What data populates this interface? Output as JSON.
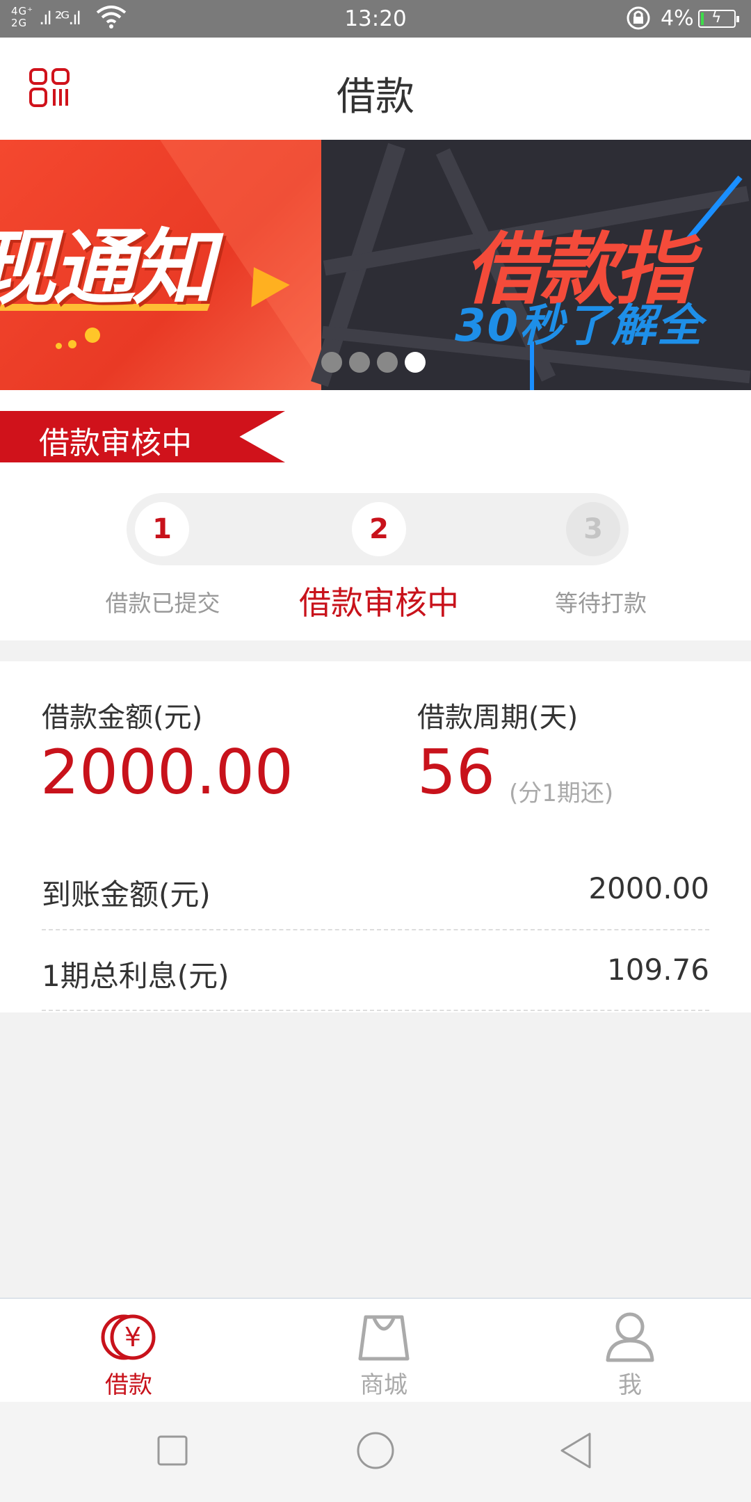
{
  "status_bar": {
    "network": "4G 2G",
    "signal2": "2G",
    "time": "13:20",
    "battery_percent": "4%",
    "icons": [
      "signal-icon",
      "wifi-icon",
      "rotation-lock-icon",
      "battery-charging-icon"
    ]
  },
  "header": {
    "title": "借款",
    "left_icon": "scan-icon"
  },
  "banner": {
    "slide_1_text": "现通知",
    "slide_2_title": "借款指",
    "slide_2_subtitle": "30秒了解全",
    "page_count": 4,
    "active_page": 4
  },
  "loan_status": {
    "ribbon": "借款审核中",
    "steps": [
      {
        "number": "1",
        "label": "借款已提交",
        "state": "done"
      },
      {
        "number": "2",
        "label": "借款审核中",
        "state": "current"
      },
      {
        "number": "3",
        "label": "等待打款",
        "state": "pending"
      }
    ]
  },
  "details": {
    "amount_label": "借款金额(元)",
    "amount_value": "2000.00",
    "period_label": "借款周期(天)",
    "period_value": "56",
    "period_note": "(分1期还)",
    "rows": [
      {
        "label": "到账金额(元)",
        "value": "2000.00"
      },
      {
        "label": "1期总利息(元)",
        "value": "109.76"
      }
    ]
  },
  "tabs": [
    {
      "label": "借款",
      "icon": "yuan-coin-icon",
      "active": true
    },
    {
      "label": "商城",
      "icon": "shopping-bag-icon",
      "active": false
    },
    {
      "label": "我",
      "icon": "user-icon",
      "active": false
    }
  ],
  "colors": {
    "brand_red": "#c8121b",
    "ribbon_red": "#d0121b",
    "muted_text": "#999999",
    "page_bg": "#f2f2f2"
  }
}
